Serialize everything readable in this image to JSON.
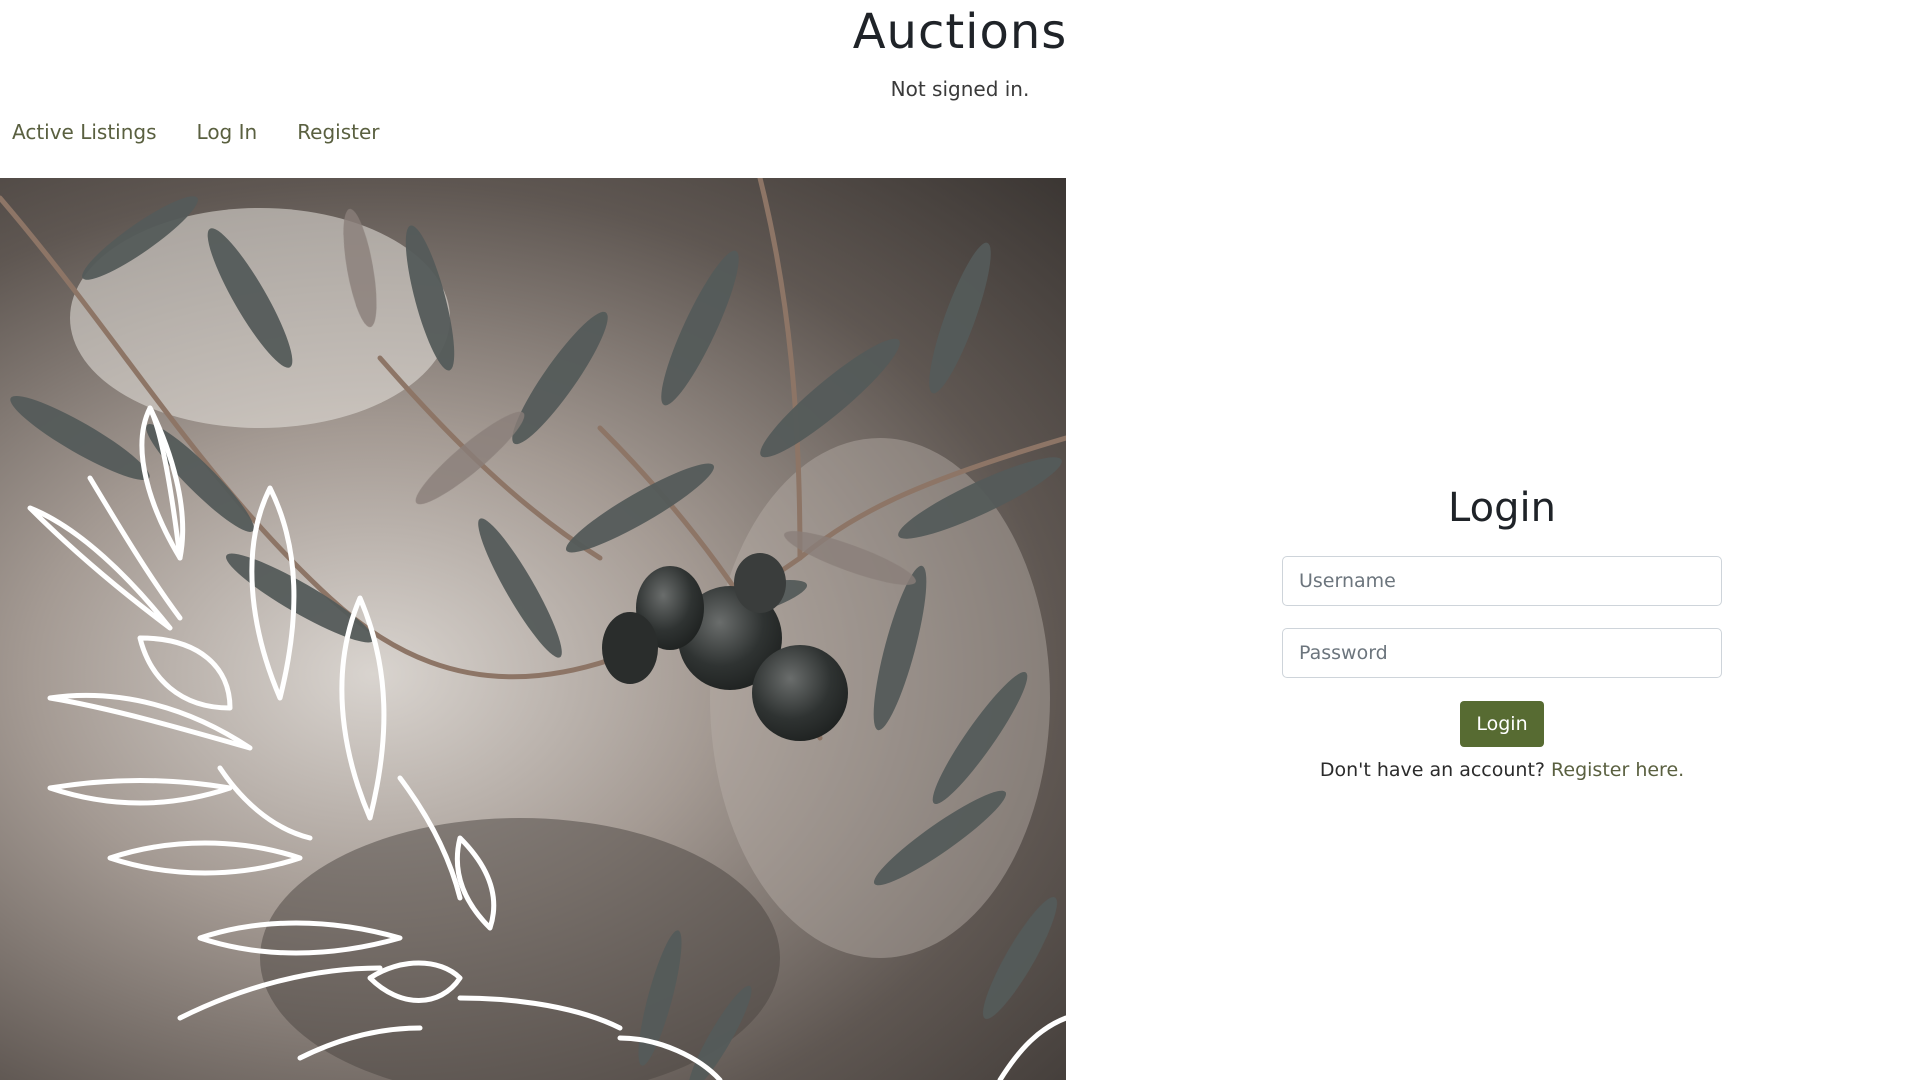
{
  "header": {
    "title": "Auctions",
    "status": "Not signed in."
  },
  "nav": {
    "items": [
      {
        "label": "Active Listings"
      },
      {
        "label": "Log In"
      },
      {
        "label": "Register"
      }
    ]
  },
  "hero": {
    "image": "olive-branch-photo"
  },
  "login": {
    "heading": "Login",
    "username_placeholder": "Username",
    "password_placeholder": "Password",
    "submit_label": "Login",
    "register_prompt": "Don't have an account?",
    "register_link": "Register here."
  },
  "colors": {
    "accent": "#576b32",
    "link": "#5a6040"
  }
}
